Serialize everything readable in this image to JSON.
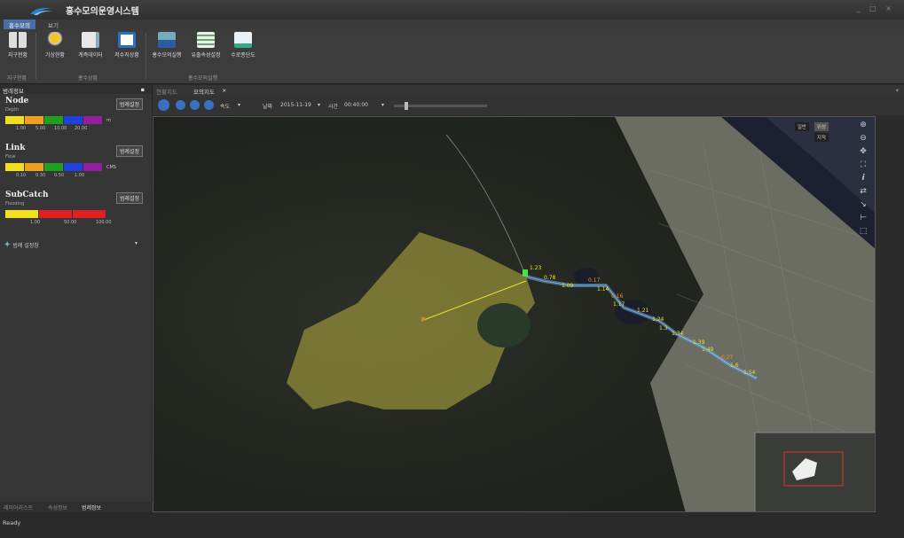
{
  "app": {
    "title": "홍수모의운영시스템",
    "window_controls": "_ □ ×"
  },
  "ribbon": {
    "tabs": [
      {
        "label": "홍수모의",
        "active": true
      },
      {
        "label": "보기",
        "active": false
      }
    ],
    "buttons": [
      {
        "label": "지구현황",
        "icon": "region-icon"
      },
      {
        "label": "기상현황",
        "icon": "weather-icon"
      },
      {
        "label": "계측데이터",
        "icon": "measurement-icon"
      },
      {
        "label": "저수지상황",
        "icon": "reservoir-icon"
      },
      {
        "label": "홍수모의실행",
        "icon": "simulation-icon"
      },
      {
        "label": "유출속성설정",
        "icon": "runoff-settings-icon"
      },
      {
        "label": "수로종단도",
        "icon": "channel-profile-icon"
      }
    ],
    "groups": [
      "지구현황",
      "홍수상황",
      "홍수모의실행"
    ]
  },
  "left_panel": {
    "title": "범례정보",
    "pin": "▪",
    "legends": [
      {
        "title": "Node",
        "subtitle": "Depth",
        "button": "범례설정",
        "unit": "m",
        "colors": [
          "#f0e020",
          "#f0a020",
          "#20a020",
          "#2040e0",
          "#9020a0"
        ],
        "ticks": [
          "1.00",
          "5.00",
          "10.00",
          "20.00"
        ]
      },
      {
        "title": "Link",
        "subtitle": "Flow",
        "button": "범례설정",
        "unit": "CMS",
        "colors": [
          "#f0e020",
          "#f0a020",
          "#20a020",
          "#2040e0",
          "#9020a0"
        ],
        "ticks": [
          "0.10",
          "0.30",
          "0.50",
          "1.00"
        ]
      },
      {
        "title": "SubCatch",
        "subtitle": "Flooding",
        "button": "범례설정",
        "unit": "",
        "colors": [
          "#f0e020",
          "#e02020",
          "#e02020",
          "#e02020"
        ],
        "ticks": [
          "1.00",
          "50.00",
          "100.00"
        ]
      }
    ],
    "settings_label": "범례 설정창",
    "bottom_tabs": [
      "레이어리스트",
      "속성정보",
      "범례정보"
    ]
  },
  "doc_tabs": [
    {
      "label": "현황지도",
      "active": false
    },
    {
      "label": "모의지도",
      "active": true
    }
  ],
  "toolbar": {
    "speed_label": "속도",
    "date_label": "날짜",
    "date_value": "2015-11-19",
    "time_label": "시간",
    "time_value": "00:40:00"
  },
  "map": {
    "types": [
      {
        "label": "일반",
        "active": false
      },
      {
        "label": "위성",
        "active": true
      }
    ],
    "hybrid_label": "지적",
    "tools": [
      "zoom-in",
      "zoom-out",
      "pan",
      "full-extent",
      "info",
      "swap",
      "select",
      "measure",
      "area"
    ],
    "link_labels": [
      "1.23",
      "0.78",
      "1.09",
      "0.17",
      "1.14",
      "0.16",
      "1.17",
      "1.21",
      "1.24",
      "1.3",
      "1.34",
      "1.39",
      "1.49",
      "0.27",
      "1.6",
      "1.54"
    ]
  },
  "status": {
    "text": "Ready"
  },
  "colors": {
    "accent": "#4a6fa5",
    "catchment": "#c8c040",
    "channel": "#5aa0e0"
  }
}
